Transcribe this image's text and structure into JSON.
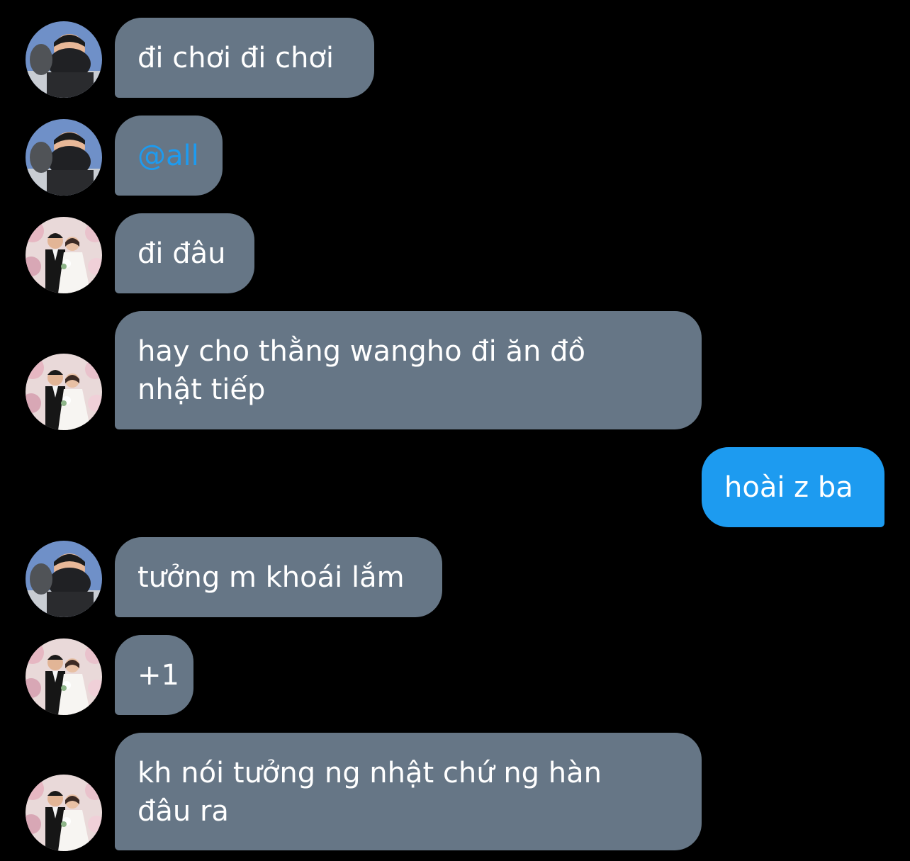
{
  "conversation": {
    "messages": [
      {
        "sender": "friend-a",
        "avatar": "avatar-masked-man",
        "text": "đi chơi đi chơi"
      },
      {
        "sender": "friend-a",
        "avatar": "avatar-masked-man",
        "text": "@all",
        "mention": true
      },
      {
        "sender": "friend-b",
        "avatar": "avatar-wedding-couple",
        "text": "đi đâu"
      },
      {
        "sender": "friend-b",
        "avatar": "avatar-wedding-couple",
        "text": "hay cho thằng wangho đi ăn đồ nhật tiếp"
      },
      {
        "sender": "me",
        "text": "hoài z ba"
      },
      {
        "sender": "friend-a",
        "avatar": "avatar-masked-man",
        "text": "tưởng m khoái lắm"
      },
      {
        "sender": "friend-b",
        "avatar": "avatar-wedding-couple",
        "text": "+1"
      },
      {
        "sender": "friend-b",
        "avatar": "avatar-wedding-couple",
        "text": "kh nói tưởng ng nhật chứ ng hàn đâu ra"
      }
    ]
  },
  "colors": {
    "background": "#000000",
    "incoming_bubble": "#667686",
    "outgoing_bubble": "#1d9bf0",
    "mention": "#1d9bf0",
    "text": "#ffffff"
  }
}
